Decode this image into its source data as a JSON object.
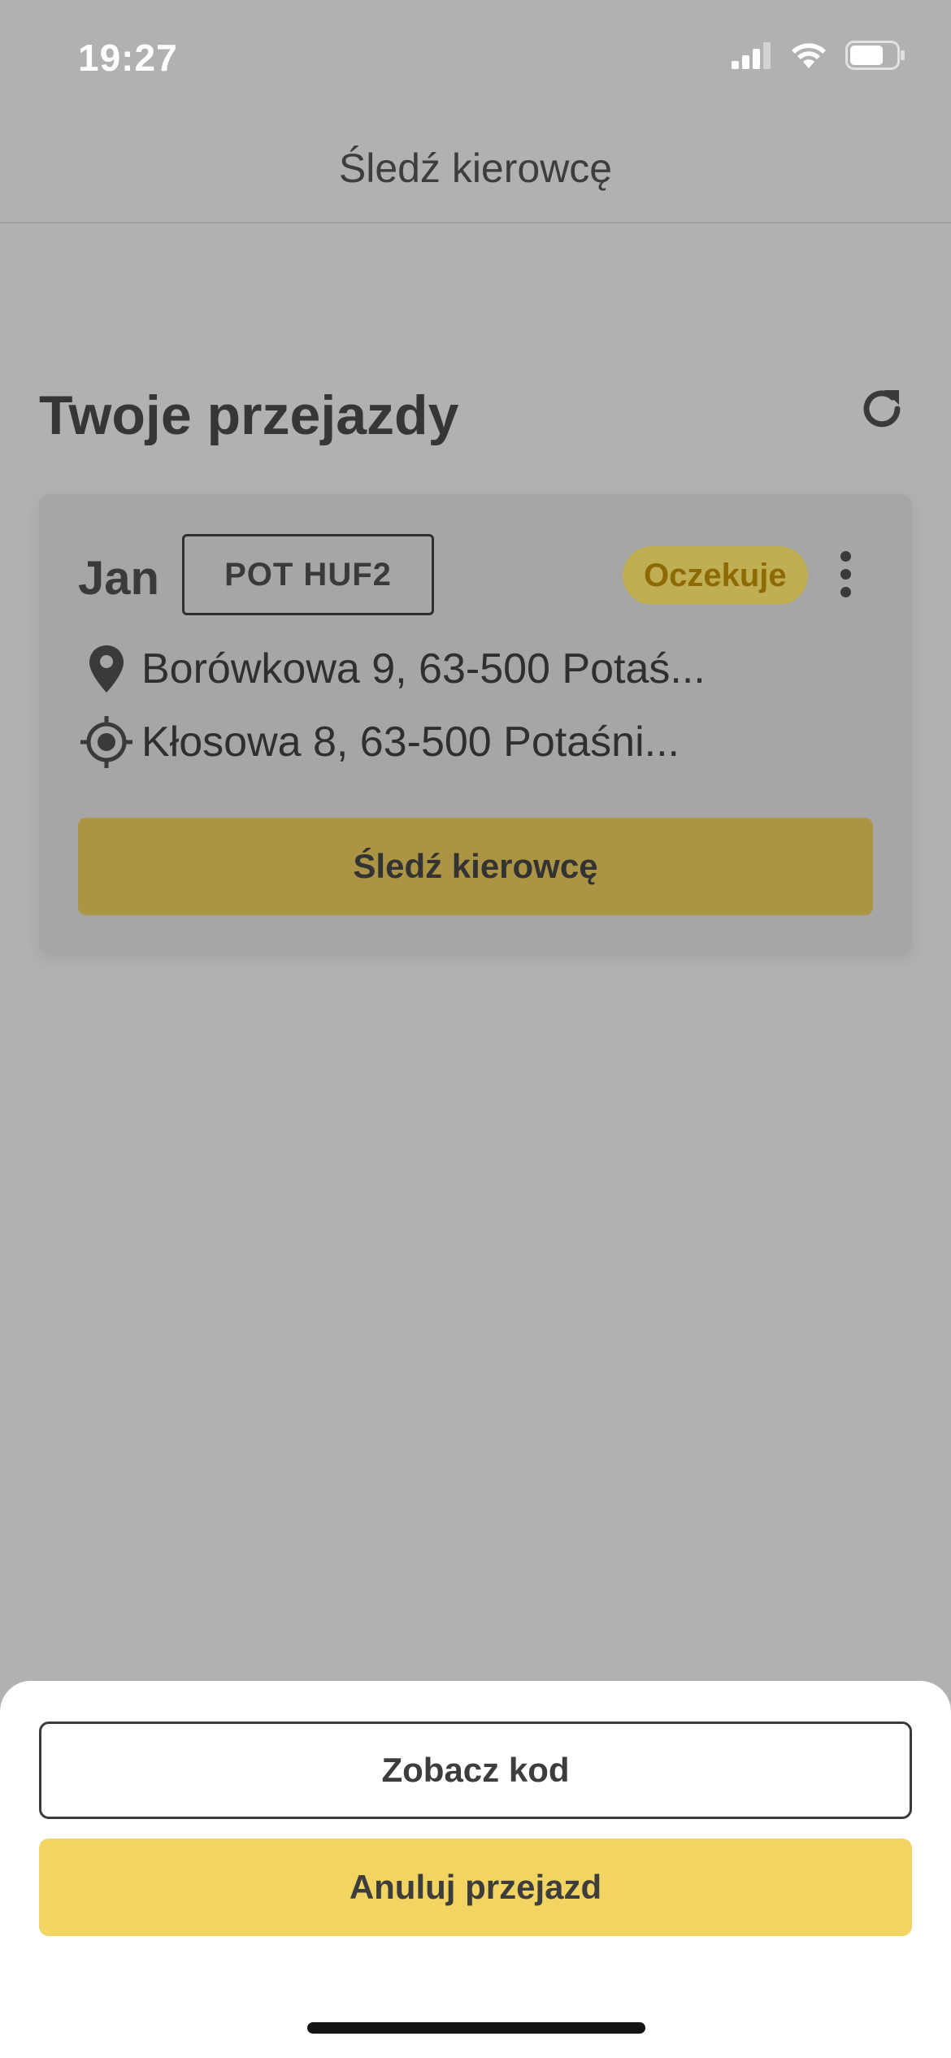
{
  "status_bar": {
    "time": "19:27",
    "icons": [
      "cellular-signal-icon",
      "wifi-icon",
      "battery-icon"
    ]
  },
  "header": {
    "title": "Śledź kierowcę"
  },
  "rides_section": {
    "title": "Twoje przejazdy",
    "refresh_icon": "refresh-icon"
  },
  "ride": {
    "driver_name": "Jan",
    "plate": "POT HUF2",
    "status": "Oczekuje",
    "pickup_address": "Borówkowa 9, 63-500 Potaś...",
    "destination_address": "Kłosowa 8, 63-500 Potaśni...",
    "track_button_label": "Śledź kierowcę"
  },
  "bottom_sheet": {
    "show_code_label": "Zobacz kod",
    "cancel_ride_label": "Anuluj przejazd"
  },
  "colors": {
    "overlay_background": "#b1b1b1",
    "accent_yellow": "#f2d462",
    "status_text": "#8e6a05"
  }
}
